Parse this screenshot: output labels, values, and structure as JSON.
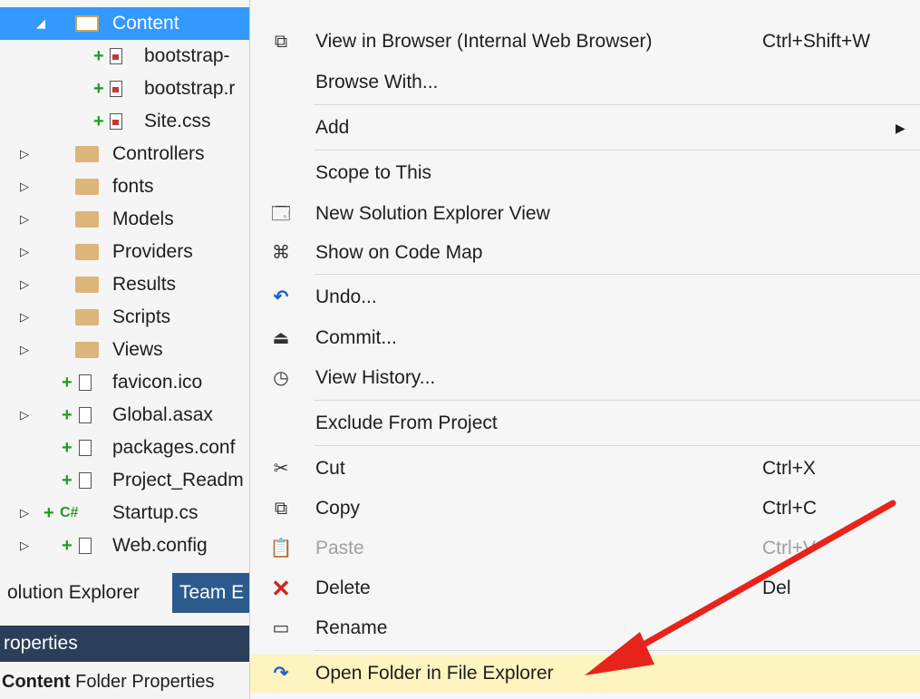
{
  "tree": {
    "items": [
      {
        "label": "Content"
      },
      {
        "label": "bootstrap-"
      },
      {
        "label": "bootstrap.r"
      },
      {
        "label": "Site.css"
      },
      {
        "label": "Controllers"
      },
      {
        "label": "fonts"
      },
      {
        "label": "Models"
      },
      {
        "label": "Providers"
      },
      {
        "label": "Results"
      },
      {
        "label": "Scripts"
      },
      {
        "label": "Views"
      },
      {
        "label": "favicon.ico"
      },
      {
        "label": "Global.asax"
      },
      {
        "label": "packages.conf"
      },
      {
        "label": "Project_Readm"
      },
      {
        "label": "Startup.cs"
      },
      {
        "label": "Web.config"
      }
    ]
  },
  "tabs": {
    "solution_explorer": "olution Explorer",
    "team_explorer": "Team E"
  },
  "properties": {
    "header": "roperties",
    "item_name": "Content",
    "item_desc": "Folder Properties"
  },
  "menu": {
    "view_in_browser": {
      "label": "View in Browser (Internal Web Browser)",
      "shortcut": "Ctrl+Shift+W"
    },
    "browse_with": {
      "label": "Browse With..."
    },
    "add": {
      "label": "Add"
    },
    "scope_to_this": {
      "label": "Scope to This"
    },
    "new_solution_explorer_view": {
      "label": "New Solution Explorer View"
    },
    "show_on_code_map": {
      "label": "Show on Code Map"
    },
    "undo": {
      "label": "Undo..."
    },
    "commit": {
      "label": "Commit..."
    },
    "view_history": {
      "label": "View History..."
    },
    "exclude_from_project": {
      "label": "Exclude From Project"
    },
    "cut": {
      "label": "Cut",
      "shortcut": "Ctrl+X"
    },
    "copy": {
      "label": "Copy",
      "shortcut": "Ctrl+C"
    },
    "paste": {
      "label": "Paste",
      "shortcut": "Ctrl+V"
    },
    "delete": {
      "label": "Delete",
      "shortcut": "Del"
    },
    "rename": {
      "label": "Rename"
    },
    "open_folder": {
      "label": "Open Folder in File Explorer"
    }
  },
  "colors": {
    "selection": "#3399ff",
    "highlight": "#fdf4bf",
    "annotation_arrow": "#e8231c",
    "folder": "#dcb67a"
  }
}
